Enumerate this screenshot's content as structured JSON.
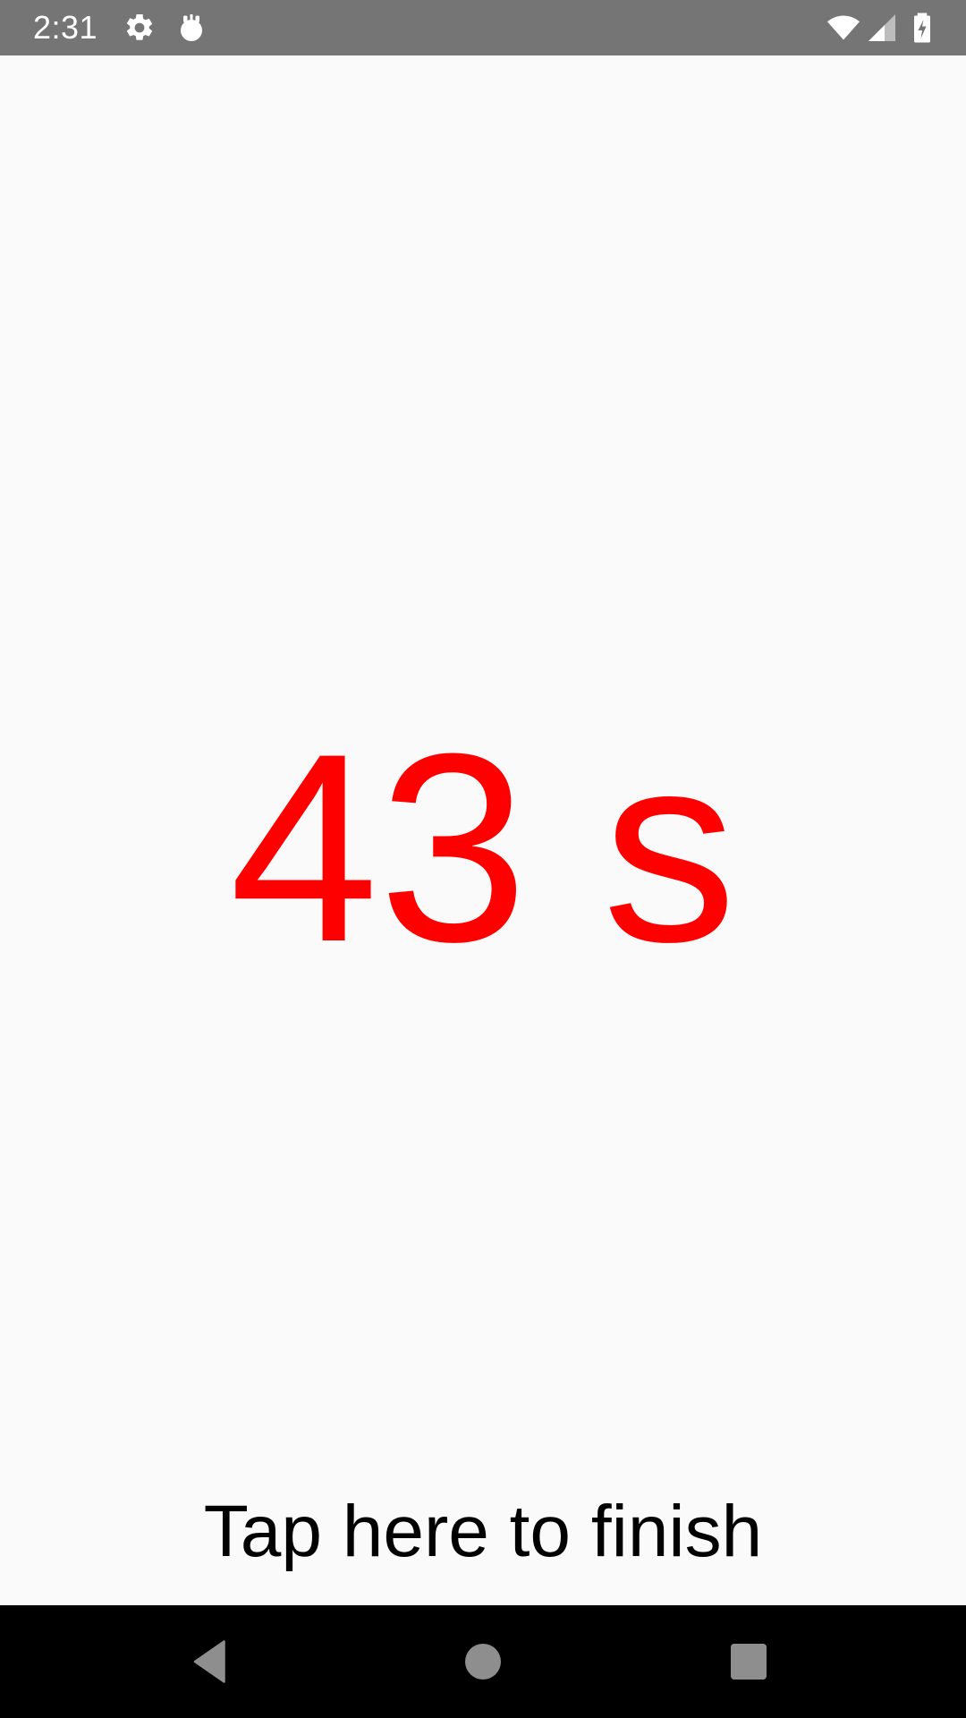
{
  "status_bar": {
    "time": "2:31",
    "background_color": "#757575",
    "icons": [
      "settings-icon",
      "notification-icon",
      "wifi-icon",
      "cell-signal-icon",
      "battery-charging-icon"
    ]
  },
  "timer": {
    "value": "43 s",
    "color": "#ff0000"
  },
  "finish": {
    "label": "Tap here to finish"
  },
  "nav_bar": {
    "buttons": [
      "back-icon",
      "home-icon",
      "recents-icon"
    ],
    "background_color": "#000000"
  }
}
